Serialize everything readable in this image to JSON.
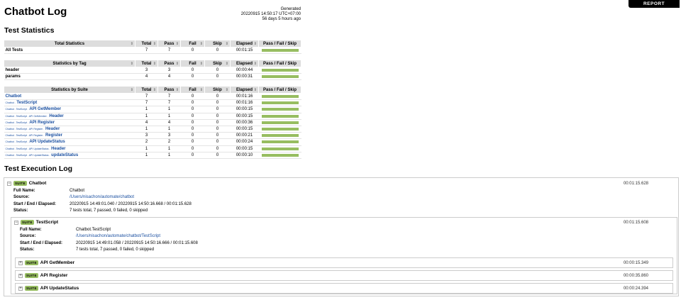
{
  "header": {
    "title": "Chatbot Log",
    "generated_label": "Generated",
    "generated_time": "20220915 14:50:17 UTC+07:00",
    "generated_ago": "56 days 5 hours ago",
    "report_button": "REPORT"
  },
  "stats": {
    "heading": "Test Statistics",
    "columns": [
      "Total",
      "Pass",
      "Fail",
      "Skip",
      "Elapsed",
      "Pass / Fail / Skip"
    ],
    "total": {
      "title": "Total Statistics",
      "rows": [
        {
          "name": "All Tests",
          "total": "7",
          "pass": "7",
          "fail": "0",
          "skip": "0",
          "elapsed": "00:01:15",
          "pass_ratio": 1
        }
      ]
    },
    "tag": {
      "title": "Statistics by Tag",
      "rows": [
        {
          "name": "header",
          "total": "3",
          "pass": "3",
          "fail": "0",
          "skip": "0",
          "elapsed": "00:00:44",
          "pass_ratio": 1
        },
        {
          "name": "params",
          "total": "4",
          "pass": "4",
          "fail": "0",
          "skip": "0",
          "elapsed": "00:00:31",
          "pass_ratio": 1
        }
      ]
    },
    "suite": {
      "title": "Statistics by Suite",
      "rows": [
        {
          "prefix": "",
          "name": "Chatbot",
          "total": "7",
          "pass": "7",
          "fail": "0",
          "skip": "0",
          "elapsed": "00:01:16",
          "pass_ratio": 1
        },
        {
          "prefix": "Chatbot .",
          "name": "TestScript",
          "total": "7",
          "pass": "7",
          "fail": "0",
          "skip": "0",
          "elapsed": "00:01:16",
          "pass_ratio": 1
        },
        {
          "prefix": "Chatbot . TestScript .",
          "name": "API GetMember",
          "total": "1",
          "pass": "1",
          "fail": "0",
          "skip": "0",
          "elapsed": "00:00:15",
          "pass_ratio": 1
        },
        {
          "prefix": "Chatbot . TestScript . API GetMember .",
          "name": "Header",
          "total": "1",
          "pass": "1",
          "fail": "0",
          "skip": "0",
          "elapsed": "00:00:15",
          "pass_ratio": 1
        },
        {
          "prefix": "Chatbot . TestScript .",
          "name": "API Register",
          "total": "4",
          "pass": "4",
          "fail": "0",
          "skip": "0",
          "elapsed": "00:00:36",
          "pass_ratio": 1
        },
        {
          "prefix": "Chatbot . TestScript . API Register .",
          "name": "Header",
          "total": "1",
          "pass": "1",
          "fail": "0",
          "skip": "0",
          "elapsed": "00:00:15",
          "pass_ratio": 1
        },
        {
          "prefix": "Chatbot . TestScript . API Register .",
          "name": "Register",
          "total": "3",
          "pass": "3",
          "fail": "0",
          "skip": "0",
          "elapsed": "00:00:21",
          "pass_ratio": 1
        },
        {
          "prefix": "Chatbot . TestScript .",
          "name": "API UpdateStatus",
          "total": "2",
          "pass": "2",
          "fail": "0",
          "skip": "0",
          "elapsed": "00:00:24",
          "pass_ratio": 1
        },
        {
          "prefix": "Chatbot . TestScript . API UpdateStatus .",
          "name": "Header",
          "total": "1",
          "pass": "1",
          "fail": "0",
          "skip": "0",
          "elapsed": "00:00:15",
          "pass_ratio": 1
        },
        {
          "prefix": "Chatbot . TestScript . API UpdateStatus .",
          "name": "updateStatus",
          "total": "1",
          "pass": "1",
          "fail": "0",
          "skip": "0",
          "elapsed": "00:00:10",
          "pass_ratio": 1
        }
      ]
    }
  },
  "log": {
    "heading": "Test Execution Log",
    "badge": "SUITE",
    "labels": {
      "full_name": "Full Name:",
      "source": "Source:",
      "times": "Start / End / Elapsed:",
      "status": "Status:"
    },
    "chatbot": {
      "name": "Chatbot",
      "elapsed": "00:01:15.628",
      "full_name": "Chatbot",
      "source": "/Users/nisachon/automate/chatbot",
      "times": "20220915 14:49:01.040 / 20220915 14:50:16.668 / 00:01:15.628",
      "status": "7 tests total, 7 passed, 0 failed, 0 skipped"
    },
    "testscript": {
      "name": "TestScript",
      "elapsed": "00:01:15.608",
      "full_name": "Chatbot.TestScript",
      "source": "/Users/nisachon/automate/chatbot/TestScript",
      "times": "20220915 14:49:01.058 / 20220915 14:50:16.666 / 00:01:15.608",
      "status": "7 tests total, 7 passed, 0 failed, 0 skipped"
    },
    "children": [
      {
        "name": "API GetMember",
        "elapsed": "00:00:15.349"
      },
      {
        "name": "API Register",
        "elapsed": "00:00:35.860"
      },
      {
        "name": "API UpdateStatus",
        "elapsed": "00:00:24.394"
      }
    ]
  }
}
